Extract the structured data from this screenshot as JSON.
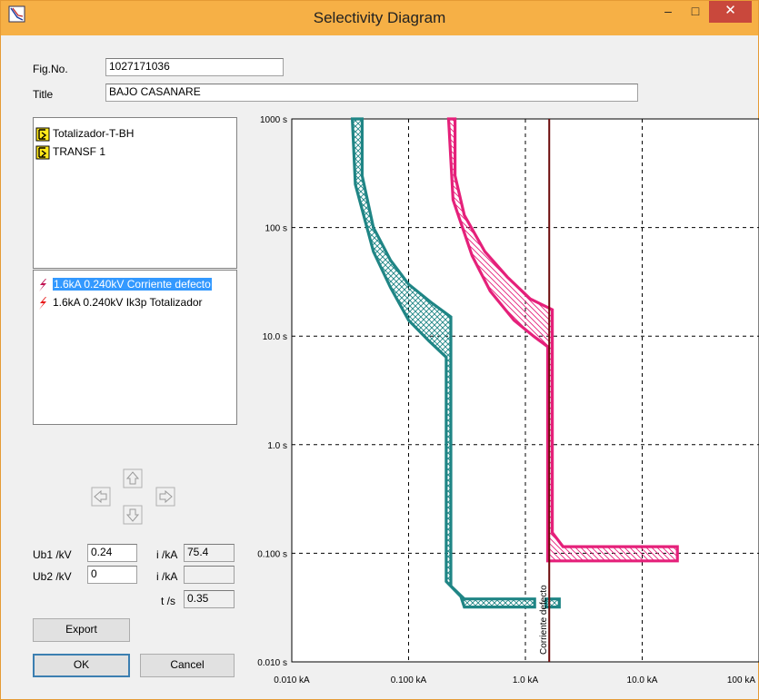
{
  "window": {
    "title": "Selectivity Diagram",
    "minimize": "–",
    "maximize": "□",
    "close": "✕"
  },
  "form": {
    "fig_label": "Fig.No.",
    "fig_value": "1027171036",
    "title_label": "Title",
    "title_value": "BAJO CASANARE"
  },
  "devices": [
    {
      "label": "Totalizador-T-BH",
      "icon": "breaker-icon"
    },
    {
      "label": "TRANSF 1",
      "icon": "breaker-icon"
    }
  ],
  "faults": [
    {
      "label": "1.6kA 0.240kV Corriente defecto",
      "icon": "fault-lightning-icon",
      "selected": true
    },
    {
      "label": "1.6kA 0.240kV Ik3p Totalizador",
      "icon": "fault-lightning-icon",
      "selected": false
    }
  ],
  "params": {
    "ub1_label": "Ub1 /kV",
    "ub1_value": "0.24",
    "ub2_label": "Ub2 /kV",
    "ub2_value": "0",
    "i1_label": "i /kA",
    "i1_value": "75.4",
    "i2_label": "i /kA",
    "i2_value": "",
    "t_label": "t /s",
    "t_value": "0.35"
  },
  "buttons": {
    "export": "Export",
    "ok": "OK",
    "cancel": "Cancel"
  },
  "chart_data": {
    "type": "line",
    "x_scale": "log",
    "y_scale": "log",
    "xlim_kA": [
      0.01,
      100
    ],
    "ylim_s": [
      0.01,
      1000
    ],
    "x_ticks": [
      "0.010 kA",
      "0.100 kA",
      "1.0 kA",
      "10.0 kA",
      "100 kA"
    ],
    "y_ticks": [
      "1000 s",
      "100 s",
      "10.0 s",
      "1.0 s",
      "0.100 s",
      "0.010 s"
    ],
    "grid": true,
    "annotation": "Corriente defecto",
    "fault_current_kA": 1.6,
    "colors": {
      "teal": "#1f8585",
      "pink": "#e5207a",
      "fault_line": "#6b0a0a"
    },
    "series": [
      {
        "color": "teal",
        "hatch": "crosshatch",
        "band": [
          [
            0.04,
            1000
          ],
          [
            0.04,
            300
          ],
          [
            0.05,
            100
          ],
          [
            0.07,
            50
          ],
          [
            0.1,
            30
          ],
          [
            0.16,
            20
          ],
          [
            0.23,
            15
          ],
          [
            0.23,
            0.05
          ],
          [
            0.3,
            0.038
          ],
          [
            1.2,
            0.038
          ],
          [
            1.2,
            0.032
          ],
          [
            0.3,
            0.032
          ],
          [
            0.28,
            0.04
          ],
          [
            0.21,
            0.055
          ],
          [
            0.21,
            6.4
          ],
          [
            0.15,
            9
          ],
          [
            0.1,
            14
          ],
          [
            0.07,
            28
          ],
          [
            0.05,
            60
          ],
          [
            0.035,
            250
          ],
          [
            0.033,
            1000
          ]
        ],
        "extra_band": [
          [
            1.5,
            0.038
          ],
          [
            1.95,
            0.038
          ],
          [
            1.95,
            0.032
          ],
          [
            1.5,
            0.032
          ]
        ]
      },
      {
        "color": "pink",
        "hatch": "diagonal",
        "band": [
          [
            0.25,
            1000
          ],
          [
            0.25,
            300
          ],
          [
            0.3,
            130
          ],
          [
            0.45,
            60
          ],
          [
            0.7,
            35
          ],
          [
            1.1,
            22
          ],
          [
            1.7,
            17.5
          ],
          [
            1.7,
            0.155
          ],
          [
            2.1,
            0.115
          ],
          [
            20,
            0.115
          ],
          [
            20,
            0.085
          ],
          [
            1.55,
            0.085
          ],
          [
            1.55,
            8
          ],
          [
            1.2,
            9.8
          ],
          [
            0.8,
            14
          ],
          [
            0.5,
            26
          ],
          [
            0.35,
            55
          ],
          [
            0.24,
            180
          ],
          [
            0.22,
            1000
          ]
        ]
      }
    ]
  }
}
